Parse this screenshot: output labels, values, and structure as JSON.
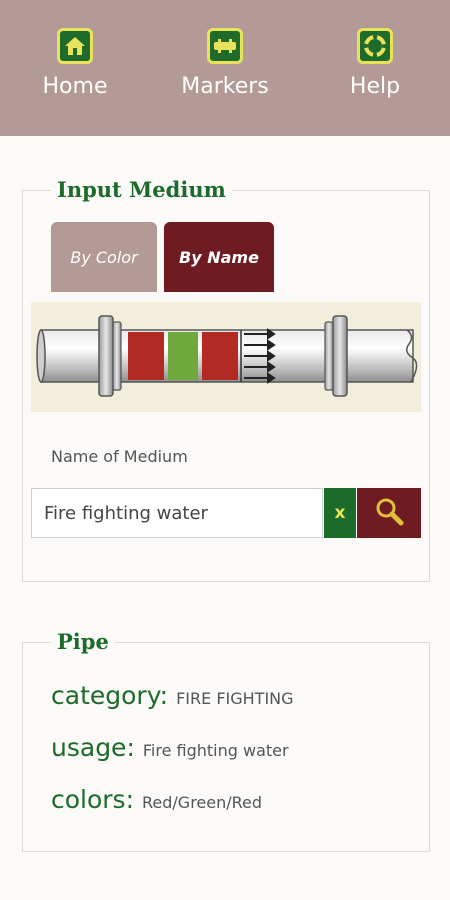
{
  "nav": {
    "home": {
      "label": "Home",
      "icon": "home-icon"
    },
    "markers": {
      "label": "Markers",
      "icon": "pipe-marker-icon"
    },
    "help": {
      "label": "Help",
      "icon": "lifebuoy-icon"
    }
  },
  "input_medium": {
    "title": "Input Medium",
    "tabs": [
      {
        "label": "By Color",
        "active": false
      },
      {
        "label": "By Name",
        "active": true
      }
    ],
    "pipe_colors": [
      "#b22a24",
      "#6fa93c",
      "#b22a24"
    ],
    "name_label": "Name of Medium",
    "search_value": "Fire fighting water",
    "clear_label": "x"
  },
  "pipe": {
    "title": "Pipe",
    "category_key": "category:",
    "category_value": "FIRE FIGHTING",
    "usage_key": "usage:",
    "usage_value": "Fire fighting water",
    "colors_key": "colors:",
    "colors_value": "Red/Green/Red"
  },
  "colors": {
    "header_bg": "#b39a96",
    "accent_green": "#1c6b2a",
    "accent_maroon": "#6e1b22",
    "icon_border": "#e9e25a"
  }
}
